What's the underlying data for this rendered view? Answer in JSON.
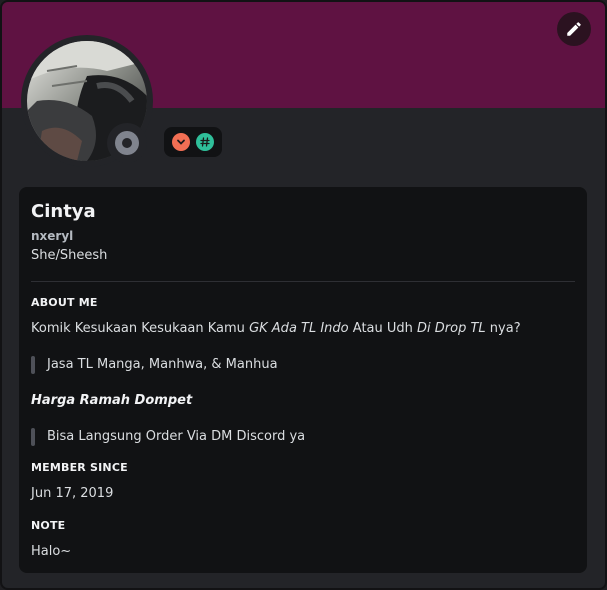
{
  "profile": {
    "display_name": "Cintya",
    "username": "nxeryl",
    "pronouns": "She/Sheesh",
    "status": "offline",
    "banner_color": "#5f1242",
    "badges": [
      {
        "icon": "chevron-down-badge-icon",
        "color": "#f26f54"
      },
      {
        "icon": "hashtag-badge-icon",
        "color": "#2fbf9a"
      }
    ]
  },
  "about": {
    "title": "ABOUT ME",
    "line1_prefix": "Komik Kesukaan Kesukaan Kamu ",
    "line1_italic1": "GK Ada TL Indo",
    "line1_mid": " Atau Udh ",
    "line1_italic2": "Di Drop TL",
    "line1_suffix": " nya?",
    "quote1": "Jasa TL Manga, Manhwa, & Manhua",
    "bold_italic": "Harga Ramah Dompet",
    "quote2": "Bisa Langsung Order Via DM Discord ya"
  },
  "member_since": {
    "title": "MEMBER SINCE",
    "date": "Jun 17, 2019"
  },
  "note": {
    "title": "NOTE",
    "value": "Halo~"
  }
}
